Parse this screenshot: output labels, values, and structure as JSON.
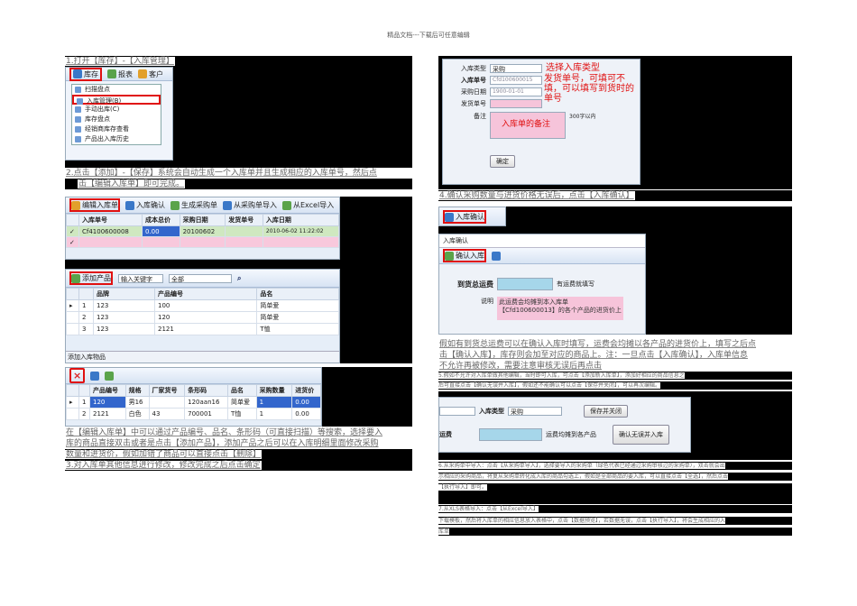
{
  "header": "精品文档---下载后可任意编辑",
  "left": {
    "step1": "1.打开【库存】-【入库管理】",
    "menu_bar": [
      "库存",
      "报表",
      "客户"
    ],
    "menu_items": [
      "扫描盘点",
      "入库管理(B)",
      "手动出库(C)",
      "库存盘点",
      "经销商库存查看",
      "产品出入库历史"
    ],
    "step2_l1": "2.点击【添加】-【保存】系统会自动生成一个入库单并且生成相应的入库单号，然后点",
    "step2_l2": "击【编辑入库单】即可完成。",
    "tb1": [
      "编辑入库单",
      "入库确认",
      "生成采购单",
      "从采购单导入",
      "从Excel导入"
    ],
    "grid1_headers": [
      "入库单号",
      "成本总价",
      "采购日期",
      "发货单号",
      "入库日期"
    ],
    "grid1_row": [
      "Cf4100600008",
      "0.00",
      "20100602",
      "",
      "2010-06-02 11:22:02"
    ],
    "tb2": [
      "添加产品",
      "输入关键字",
      "全部"
    ],
    "grid2_headers": [
      "品牌",
      "产品编号",
      "品名"
    ],
    "grid2_rows": [
      [
        "1",
        "123",
        "100",
        "简单爱"
      ],
      [
        "2",
        "123",
        "120",
        "简单爱"
      ],
      [
        "3",
        "123",
        "2121",
        "T恤"
      ]
    ],
    "tab_label": "添加入库物品",
    "grid3_headers": [
      "产品编号",
      "规格",
      "厂家货号",
      "条形码",
      "品名",
      "采购数量",
      "进货价"
    ],
    "grid3_rows": [
      [
        "1",
        "120",
        "男16",
        "",
        "120aan16",
        "简单爱",
        "1",
        "0.00"
      ],
      [
        "2",
        "2121",
        "白色",
        "43",
        "700001",
        "T恤",
        "1",
        "0.00"
      ]
    ],
    "step2_p1": "在【编辑入库单】中可以通过产品编号、品名、条形码（可直接扫描）等搜索，选择要入",
    "step2_p2": "库的商品直接双击或者是点击【添加产品】，添加产品之后可以在入库明细里面修改采购",
    "step2_p3": "数量和进货价，假如加错了商品可以直接点击【删除】",
    "step3": "3.对入库单其他信息进行修改，修改完成之后点击确定"
  },
  "right": {
    "form": {
      "type_label": "入库类型",
      "type_value": "采购",
      "no_label": "入库单号",
      "no_value": "Cfd100600015",
      "date_label": "采购日期",
      "date_value": "1900-01-01",
      "ship_label": "发货单号",
      "remark_label": "备注",
      "remark_hint": "入库单的备注",
      "limit": "300字以内",
      "ok": "确定",
      "note1": "选择入库类型",
      "note2": "发货单号，可填可不填，可以填写到货时的单号"
    },
    "step4": "4.确认采购数量与进货价格无误后，点击【入库确认】",
    "tb_confirm": "入库确认",
    "panel_title": "入库确认",
    "panel_btn": "确认入库",
    "freight_label": "到货总运费",
    "freight_hint": "有运费就填写",
    "desc_label": "说明",
    "desc_text": "此运费会均摊到本入库单【Cfd100600013】的各个产品的进货价上",
    "p4_l1": "假如有到货总运费可以在确认入库时填写，运费会均摊以各产品的进货价上，填写之后点",
    "p4_l2": "击【确认入库】，库存则会加至对应的商品上。注：一旦点击【入库确认】，入库单信息",
    "p4_l3": "不允许再被修改，需要注意审核无误后再点击",
    "p5_l1": "5.假如不允许对入库单做其他编辑，当时即可入库，可点击【添加新入库单】，添加好相应的商品信息之",
    "p5_l2": "后可直接点击【确认无误并入库】，假如还不能确认可以点击【保存并关闭】，可以再次编辑。",
    "save_close": "保存并关闭",
    "confirm_in": "确认无误并入库",
    "form2_type_label": "入库类型",
    "form2_type_value": "采购",
    "form2_freight": "运费",
    "form2_hint": "运费均摊到各产品",
    "p6_l1": "6.从采购单中导入：点击【从采购单导入】，选择要导入的采购单（绿色代表已经通过采购审核过的采购单），双击就会出",
    "p6_l2": "示相应的采购商品，将复从采购单转化成入库的商品勾选上，假如是全部商品的要入库，可以直接点击【全选】，然后点击",
    "p6_l3": "【执行导入】即可。",
    "p7_l1": "7.从XLS表格导入：点击【从Excel导入】",
    "p7_l2": "下载模板，然后将入库单的相应信息放入表格中，点击【数据预览】，若数据无误，点击【执行导入】，将会生成相应的入",
    "p7_l3": "库单"
  }
}
